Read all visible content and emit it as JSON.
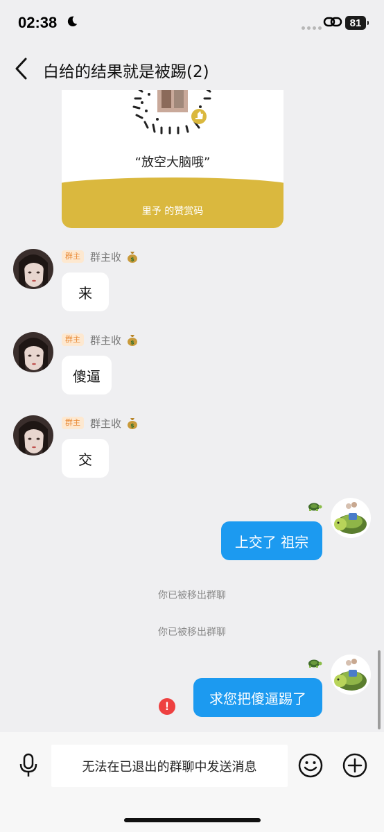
{
  "status_bar": {
    "time": "02:38",
    "battery": "81",
    "icons": [
      "moon-icon",
      "signal-dots-icon",
      "link-icon",
      "battery-icon"
    ]
  },
  "header": {
    "title": "白给的结果就是被踢(2)",
    "back_icon": "chevron-left-icon"
  },
  "reward_card": {
    "quote": "“放空大脑哦”",
    "label": "里予 的赞赏码",
    "band_color": "#dab83e"
  },
  "messages": [
    {
      "direction": "in",
      "badge": "群主",
      "sender": "群主收",
      "sender_icon": "money-bag-icon",
      "text": "来"
    },
    {
      "direction": "in",
      "badge": "群主",
      "sender": "群主收",
      "sender_icon": "money-bag-icon",
      "text": "傻逼"
    },
    {
      "direction": "in",
      "badge": "群主",
      "sender": "群主收",
      "sender_icon": "money-bag-icon",
      "text": "交"
    },
    {
      "direction": "out",
      "sender_icon": "turtle-icon",
      "text": "上交了 祖宗"
    },
    {
      "direction": "out",
      "sender_icon": "turtle-icon",
      "text": "求您把傻逼踢了",
      "failed": true
    }
  ],
  "system_notes": [
    "你已被移出群聊",
    "你已被移出群聊"
  ],
  "input_bar": {
    "placeholder": "无法在已退出的群聊中发送消息",
    "icons": [
      "microphone-icon",
      "emoji-icon",
      "plus-icon"
    ]
  },
  "colors": {
    "background": "#efeff1",
    "outgoing_bubble": "#1c9af0",
    "badge_bg": "#fde8d0",
    "badge_text": "#e98c3a",
    "error": "#ee4040"
  }
}
